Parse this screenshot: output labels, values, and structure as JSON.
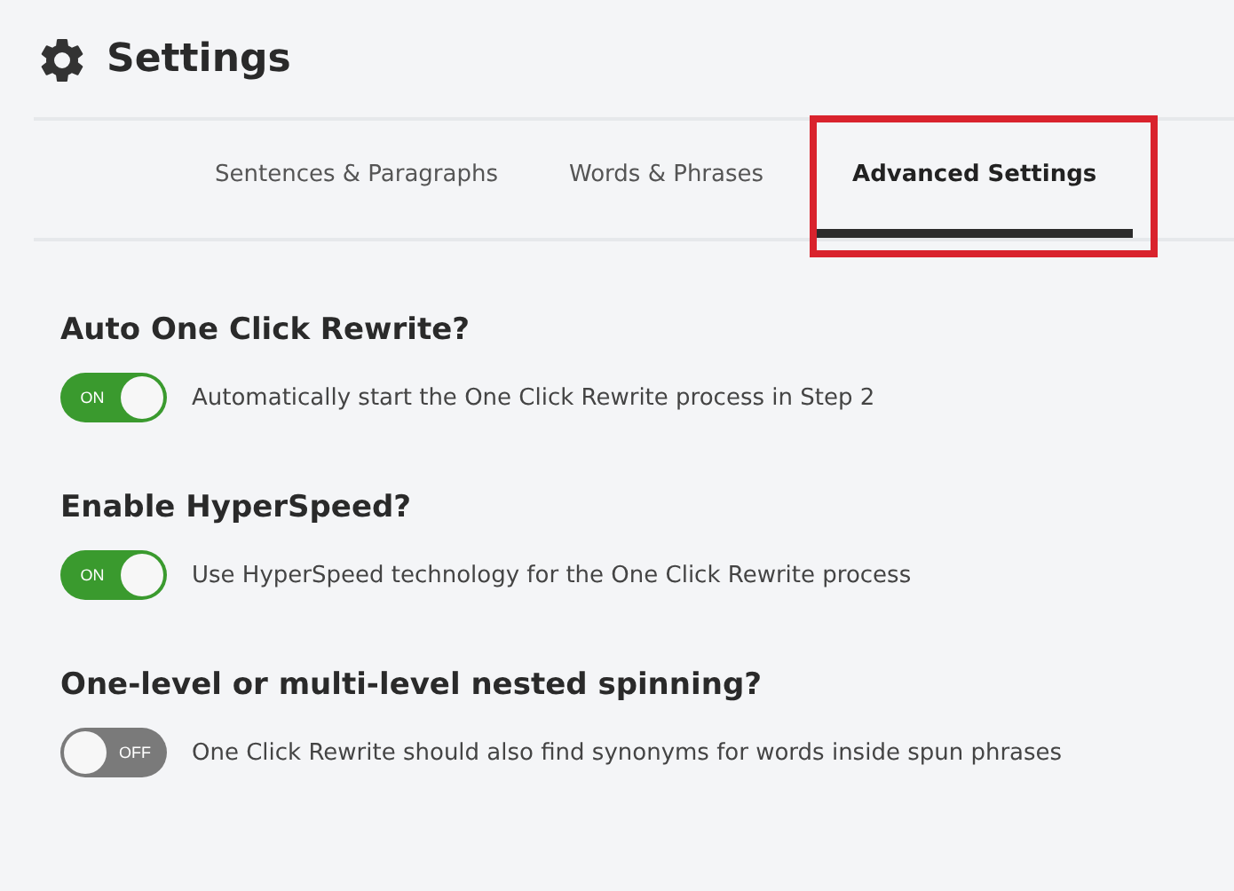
{
  "header": {
    "title": "Settings"
  },
  "tabs": [
    {
      "label": "Sentences & Paragraphs",
      "selected": false,
      "highlighted": false
    },
    {
      "label": "Words & Phrases",
      "selected": false,
      "highlighted": false
    },
    {
      "label": "Advanced Settings",
      "selected": true,
      "highlighted": true
    }
  ],
  "settings": [
    {
      "title": "Auto One Click Rewrite?",
      "on": true,
      "switch_label": "ON",
      "description": "Automatically start the One Click Rewrite process in Step 2"
    },
    {
      "title": "Enable HyperSpeed?",
      "on": true,
      "switch_label": "ON",
      "description": "Use HyperSpeed technology for the One Click Rewrite process"
    },
    {
      "title": "One-level or multi-level nested spinning?",
      "on": false,
      "switch_label": "OFF",
      "description": "One Click Rewrite should also find synonyms for words inside spun phrases"
    }
  ]
}
